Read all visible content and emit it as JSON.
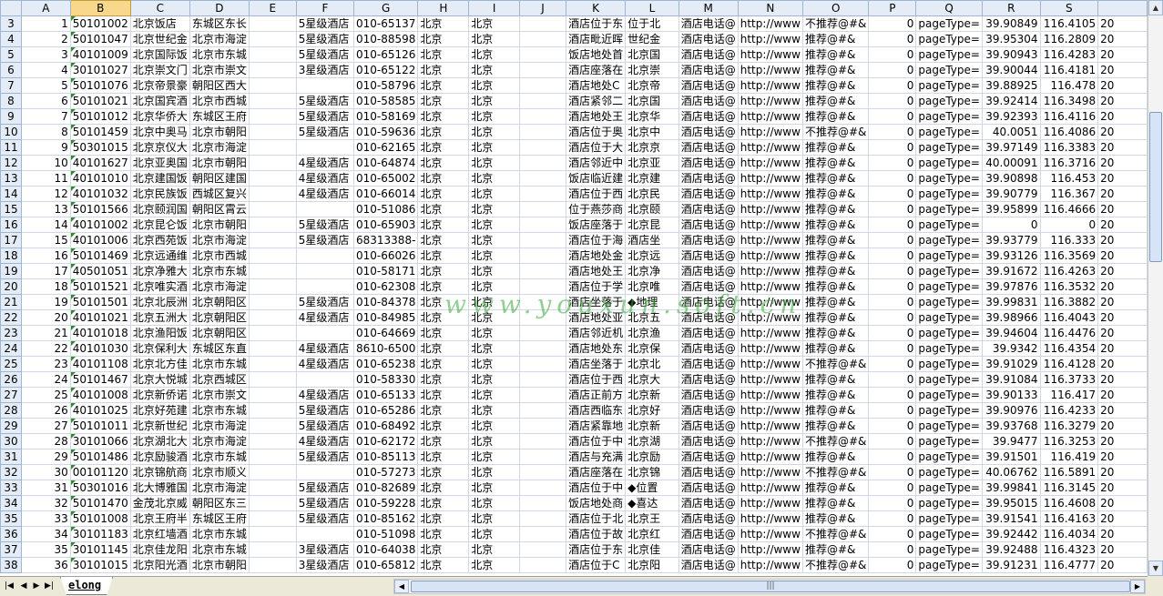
{
  "columns": [
    "A",
    "B",
    "C",
    "D",
    "E",
    "F",
    "G",
    "H",
    "I",
    "J",
    "K",
    "L",
    "M",
    "N",
    "O",
    "P",
    "Q",
    "R",
    "S"
  ],
  "selected_column": "B",
  "rows": [
    {
      "r": "3",
      "a": "1",
      "b": "50101002",
      "c": "北京饭店",
      "d": "东城区东长",
      "e": "",
      "f": "5星级酒店",
      "g": "010-65137",
      "h": "北京",
      "i": "北京",
      "j": "",
      "k": "酒店位于东",
      "l": "位于北",
      "m": "酒店电话@",
      "n": "http://www",
      "o": "不推荐@#&",
      "p": "0",
      "q": "pageType=",
      "r2": "39.90849",
      "s": "116.4105",
      "t": "20"
    },
    {
      "r": "4",
      "a": "2",
      "b": "50101047",
      "c": "北京世纪金",
      "d": "北京市海淀",
      "e": "",
      "f": "5星级酒店",
      "g": "010-88598",
      "h": "北京",
      "i": "北京",
      "j": "",
      "k": "酒店毗近晖",
      "l": "世纪金",
      "m": "酒店电话@",
      "n": "http://www",
      "o": "推荐@#&",
      "p": "0",
      "q": "pageType=",
      "r2": "39.95304",
      "s": "116.2809",
      "t": "20"
    },
    {
      "r": "5",
      "a": "3",
      "b": "40101009",
      "c": "北京国际饭",
      "d": "北京市东城",
      "e": "",
      "f": "5星级酒店",
      "g": "010-65126",
      "h": "北京",
      "i": "北京",
      "j": "",
      "k": "饭店地处首",
      "l": "北京国",
      "m": "酒店电话@",
      "n": "http://www",
      "o": "推荐@#&",
      "p": "0",
      "q": "pageType=",
      "r2": "39.90943",
      "s": "116.4283",
      "t": "20"
    },
    {
      "r": "6",
      "a": "4",
      "b": "30101027",
      "c": "北京崇文门",
      "d": "北京市崇文",
      "e": "",
      "f": "3星级酒店",
      "g": "010-65122",
      "h": "北京",
      "i": "北京",
      "j": "",
      "k": "酒店座落在",
      "l": "北京崇",
      "m": "酒店电话@",
      "n": "http://www",
      "o": "推荐@#&",
      "p": "0",
      "q": "pageType=",
      "r2": "39.90044",
      "s": "116.4181",
      "t": "20"
    },
    {
      "r": "7",
      "a": "5",
      "b": "50101076",
      "c": "北京帝景豪",
      "d": "朝阳区西大",
      "e": "",
      "f": "",
      "g": "010-58796",
      "h": "北京",
      "i": "北京",
      "j": "",
      "k": "酒店地处C",
      "l": "北京帝",
      "m": "酒店电话@",
      "n": "http://www",
      "o": "推荐@#&",
      "p": "0",
      "q": "pageType=",
      "r2": "39.88925",
      "s": "116.478",
      "t": "20"
    },
    {
      "r": "8",
      "a": "6",
      "b": "50101021",
      "c": "北京国宾酒",
      "d": "北京市西城",
      "e": "",
      "f": "5星级酒店",
      "g": "010-58585",
      "h": "北京",
      "i": "北京",
      "j": "",
      "k": "酒店紧邻二",
      "l": "北京国",
      "m": "酒店电话@",
      "n": "http://www",
      "o": "推荐@#&",
      "p": "0",
      "q": "pageType=",
      "r2": "39.92414",
      "s": "116.3498",
      "t": "20"
    },
    {
      "r": "9",
      "a": "7",
      "b": "50101012",
      "c": "北京华侨大",
      "d": "东城区王府",
      "e": "",
      "f": "5星级酒店",
      "g": "010-58169",
      "h": "北京",
      "i": "北京",
      "j": "",
      "k": "酒店地处王",
      "l": "北京华",
      "m": "酒店电话@",
      "n": "http://www",
      "o": "推荐@#&",
      "p": "0",
      "q": "pageType=",
      "r2": "39.92393",
      "s": "116.4116",
      "t": "20"
    },
    {
      "r": "10",
      "a": "8",
      "b": "50101459",
      "c": "北京中奥马",
      "d": "北京市朝阳",
      "e": "",
      "f": "5星级酒店",
      "g": "010-59636",
      "h": "北京",
      "i": "北京",
      "j": "",
      "k": "酒店位于奥",
      "l": "北京中",
      "m": "酒店电话@",
      "n": "http://www",
      "o": "不推荐@#&",
      "p": "0",
      "q": "pageType=",
      "r2": "40.0051",
      "s": "116.4086",
      "t": "20"
    },
    {
      "r": "11",
      "a": "9",
      "b": "50301015",
      "c": "北京京仪大",
      "d": "北京市海淀",
      "e": "",
      "f": "",
      "g": "010-62165",
      "h": "北京",
      "i": "北京",
      "j": "",
      "k": "酒店位于大",
      "l": "北京京",
      "m": "酒店电话@",
      "n": "http://www",
      "o": "推荐@#&",
      "p": "0",
      "q": "pageType=",
      "r2": "39.97149",
      "s": "116.3383",
      "t": "20"
    },
    {
      "r": "12",
      "a": "10",
      "b": "40101627",
      "c": "北京亚奥国",
      "d": "北京市朝阳",
      "e": "",
      "f": "4星级酒店",
      "g": "010-64874",
      "h": "北京",
      "i": "北京",
      "j": "",
      "k": "酒店邻近中",
      "l": "北京亚",
      "m": "酒店电话@",
      "n": "http://www",
      "o": "推荐@#&",
      "p": "0",
      "q": "pageType=",
      "r2": "40.00091",
      "s": "116.3716",
      "t": "20"
    },
    {
      "r": "13",
      "a": "11",
      "b": "40101010",
      "c": "北京建国饭",
      "d": "朝阳区建国",
      "e": "",
      "f": "4星级酒店",
      "g": "010-65002",
      "h": "北京",
      "i": "北京",
      "j": "",
      "k": "饭店临近建",
      "l": "北京建",
      "m": "酒店电话@",
      "n": "http://www",
      "o": "推荐@#&",
      "p": "0",
      "q": "pageType=",
      "r2": "39.90898",
      "s": "116.453",
      "t": "20"
    },
    {
      "r": "14",
      "a": "12",
      "b": "40101032",
      "c": "北京民族饭",
      "d": "西城区复兴",
      "e": "",
      "f": "4星级酒店",
      "g": "010-66014",
      "h": "北京",
      "i": "北京",
      "j": "",
      "k": "酒店位于西",
      "l": "北京民",
      "m": "酒店电话@",
      "n": "http://www",
      "o": "推荐@#&",
      "p": "0",
      "q": "pageType=",
      "r2": "39.90779",
      "s": "116.367",
      "t": "20"
    },
    {
      "r": "15",
      "a": "13",
      "b": "50101566",
      "c": "北京颐润国",
      "d": "朝阳区霄云",
      "e": "",
      "f": "",
      "g": "010-51086",
      "h": "北京",
      "i": "北京",
      "j": "",
      "k": "位于燕莎商",
      "l": "北京颐",
      "m": "酒店电话@",
      "n": "http://www",
      "o": "推荐@#&",
      "p": "0",
      "q": "pageType=",
      "r2": "39.95899",
      "s": "116.4666",
      "t": "20"
    },
    {
      "r": "16",
      "a": "14",
      "b": "40101002",
      "c": "北京昆仑饭",
      "d": "北京市朝阳",
      "e": "",
      "f": "5星级酒店",
      "g": "010-65903",
      "h": "北京",
      "i": "北京",
      "j": "",
      "k": "饭店座落于",
      "l": "北京昆",
      "m": "酒店电话@",
      "n": "http://www",
      "o": "推荐@#&",
      "p": "0",
      "q": "pageType=",
      "r2": "0",
      "s": "0",
      "t": "20"
    },
    {
      "r": "17",
      "a": "15",
      "b": "40101006",
      "c": "北京西苑饭",
      "d": "北京市海淀",
      "e": "",
      "f": "5星级酒店",
      "g": "68313388-",
      "h": "北京",
      "i": "北京",
      "j": "",
      "k": "酒店位于海",
      "l": "酒店坐",
      "m": "酒店电话@",
      "n": "http://www",
      "o": "推荐@#&",
      "p": "0",
      "q": "pageType=",
      "r2": "39.93779",
      "s": "116.333",
      "t": "20"
    },
    {
      "r": "18",
      "a": "16",
      "b": "50101469",
      "c": "北京远通维",
      "d": "北京市西城",
      "e": "",
      "f": "",
      "g": "010-66026",
      "h": "北京",
      "i": "北京",
      "j": "",
      "k": "酒店地处金",
      "l": "北京远",
      "m": "酒店电话@",
      "n": "http://www",
      "o": "推荐@#&",
      "p": "0",
      "q": "pageType=",
      "r2": "39.93126",
      "s": "116.3569",
      "t": "20"
    },
    {
      "r": "19",
      "a": "17",
      "b": "40501051",
      "c": "北京净雅大",
      "d": "北京市东城",
      "e": "",
      "f": "",
      "g": "010-58171",
      "h": "北京",
      "i": "北京",
      "j": "",
      "k": "酒店地处王",
      "l": "北京净",
      "m": "酒店电话@",
      "n": "http://www",
      "o": "推荐@#&",
      "p": "0",
      "q": "pageType=",
      "r2": "39.91672",
      "s": "116.4263",
      "t": "20"
    },
    {
      "r": "20",
      "a": "18",
      "b": "50101521",
      "c": "北京唯实酒",
      "d": "北京市海淀",
      "e": "",
      "f": "",
      "g": "010-62308",
      "h": "北京",
      "i": "北京",
      "j": "",
      "k": "酒店位于学",
      "l": "北京唯",
      "m": "酒店电话@",
      "n": "http://www",
      "o": "推荐@#&",
      "p": "0",
      "q": "pageType=",
      "r2": "39.97876",
      "s": "116.3532",
      "t": "20"
    },
    {
      "r": "21",
      "a": "19",
      "b": "50101501",
      "c": "北京北辰洲",
      "d": "北京朝阳区",
      "e": "",
      "f": "5星级酒店",
      "g": "010-84378",
      "h": "北京",
      "i": "北京",
      "j": "",
      "k": "酒店坐落于",
      "l": "◆地理",
      "m": "酒店电话@",
      "n": "http://www",
      "o": "推荐@#&",
      "p": "0",
      "q": "pageType=",
      "r2": "39.99831",
      "s": "116.3882",
      "t": "20"
    },
    {
      "r": "22",
      "a": "20",
      "b": "40101021",
      "c": "北京五洲大",
      "d": "北京朝阳区",
      "e": "",
      "f": "4星级酒店",
      "g": "010-84985",
      "h": "北京",
      "i": "北京",
      "j": "",
      "k": "酒店地处亚",
      "l": "北京五",
      "m": "酒店电话@",
      "n": "http://www",
      "o": "推荐@#&",
      "p": "0",
      "q": "pageType=",
      "r2": "39.98966",
      "s": "116.4043",
      "t": "20"
    },
    {
      "r": "23",
      "a": "21",
      "b": "40101018",
      "c": "北京渔阳饭",
      "d": "北京朝阳区",
      "e": "",
      "f": "",
      "g": "010-64669",
      "h": "北京",
      "i": "北京",
      "j": "",
      "k": "酒店邻近机",
      "l": "北京渔",
      "m": "酒店电话@",
      "n": "http://www",
      "o": "推荐@#&",
      "p": "0",
      "q": "pageType=",
      "r2": "39.94604",
      "s": "116.4476",
      "t": "20"
    },
    {
      "r": "24",
      "a": "22",
      "b": "40101030",
      "c": "北京保利大",
      "d": "东城区东直",
      "e": "",
      "f": "4星级酒店",
      "g": "8610-6500",
      "h": "北京",
      "i": "北京",
      "j": "",
      "k": "酒店地处东",
      "l": "北京保",
      "m": "酒店电话@",
      "n": "http://www",
      "o": "推荐@#&",
      "p": "0",
      "q": "pageType=",
      "r2": "39.9342",
      "s": "116.4354",
      "t": "20"
    },
    {
      "r": "25",
      "a": "23",
      "b": "40101108",
      "c": "北京北方佳",
      "d": "北京市东城",
      "e": "",
      "f": "4星级酒店",
      "g": "010-65238",
      "h": "北京",
      "i": "北京",
      "j": "",
      "k": "酒店坐落于",
      "l": "北京北",
      "m": "酒店电话@",
      "n": "http://www",
      "o": "不推荐@#&",
      "p": "0",
      "q": "pageType=",
      "r2": "39.91029",
      "s": "116.4128",
      "t": "20"
    },
    {
      "r": "26",
      "a": "24",
      "b": "50101467",
      "c": "北京大悦城",
      "d": "北京西城区",
      "e": "",
      "f": "",
      "g": "010-58330",
      "h": "北京",
      "i": "北京",
      "j": "",
      "k": "酒店位于西",
      "l": "北京大",
      "m": "酒店电话@",
      "n": "http://www",
      "o": "推荐@#&",
      "p": "0",
      "q": "pageType=",
      "r2": "39.91084",
      "s": "116.3733",
      "t": "20"
    },
    {
      "r": "27",
      "a": "25",
      "b": "40101008",
      "c": "北京新侨诺",
      "d": "北京市崇文",
      "e": "",
      "f": "4星级酒店",
      "g": "010-65133",
      "h": "北京",
      "i": "北京",
      "j": "",
      "k": "酒店正前方",
      "l": "北京新",
      "m": "酒店电话@",
      "n": "http://www",
      "o": "推荐@#&",
      "p": "0",
      "q": "pageType=",
      "r2": "39.90133",
      "s": "116.417",
      "t": "20"
    },
    {
      "r": "28",
      "a": "26",
      "b": "40101025",
      "c": "北京好苑建",
      "d": "北京市东城",
      "e": "",
      "f": "5星级酒店",
      "g": "010-65286",
      "h": "北京",
      "i": "北京",
      "j": "",
      "k": "酒店西临东",
      "l": "北京好",
      "m": "酒店电话@",
      "n": "http://www",
      "o": "推荐@#&",
      "p": "0",
      "q": "pageType=",
      "r2": "39.90976",
      "s": "116.4233",
      "t": "20"
    },
    {
      "r": "29",
      "a": "27",
      "b": "50101011",
      "c": "北京新世纪",
      "d": "北京市海淀",
      "e": "",
      "f": "5星级酒店",
      "g": "010-68492",
      "h": "北京",
      "i": "北京",
      "j": "",
      "k": "酒店紧靠地",
      "l": "北京新",
      "m": "酒店电话@",
      "n": "http://www",
      "o": "推荐@#&",
      "p": "0",
      "q": "pageType=",
      "r2": "39.93768",
      "s": "116.3279",
      "t": "20"
    },
    {
      "r": "30",
      "a": "28",
      "b": "30101066",
      "c": "北京湖北大",
      "d": "北京市海淀",
      "e": "",
      "f": "4星级酒店",
      "g": "010-62172",
      "h": "北京",
      "i": "北京",
      "j": "",
      "k": "酒店位于中",
      "l": "北京湖",
      "m": "酒店电话@",
      "n": "http://www",
      "o": "不推荐@#&",
      "p": "0",
      "q": "pageType=",
      "r2": "39.9477",
      "s": "116.3253",
      "t": "20"
    },
    {
      "r": "31",
      "a": "29",
      "b": "50101486",
      "c": "北京励骏酒",
      "d": "北京市东城",
      "e": "",
      "f": "5星级酒店",
      "g": "010-85113",
      "h": "北京",
      "i": "北京",
      "j": "",
      "k": "酒店与充满",
      "l": "北京励",
      "m": "酒店电话@",
      "n": "http://www",
      "o": "推荐@#&",
      "p": "0",
      "q": "pageType=",
      "r2": "39.91501",
      "s": "116.419",
      "t": "20"
    },
    {
      "r": "32",
      "a": "30",
      "b": "00101120",
      "c": "北京锦航商",
      "d": "北京市顺义",
      "e": "",
      "f": "",
      "g": "010-57273",
      "h": "北京",
      "i": "北京",
      "j": "",
      "k": "酒店座落在",
      "l": "北京锦",
      "m": "酒店电话@",
      "n": "http://www",
      "o": "不推荐@#&",
      "p": "0",
      "q": "pageType=",
      "r2": "40.06762",
      "s": "116.5891",
      "t": "20"
    },
    {
      "r": "33",
      "a": "31",
      "b": "50301016",
      "c": "北大博雅国",
      "d": "北京市海淀",
      "e": "",
      "f": "5星级酒店",
      "g": "010-82689",
      "h": "北京",
      "i": "北京",
      "j": "",
      "k": "酒店位于中",
      "l": "◆位置",
      "m": "酒店电话@",
      "n": "http://www",
      "o": "推荐@#&",
      "p": "0",
      "q": "pageType=",
      "r2": "39.99841",
      "s": "116.3145",
      "t": "20"
    },
    {
      "r": "34",
      "a": "32",
      "b": "50101470",
      "c": "金茂北京威",
      "d": "朝阳区东三",
      "e": "",
      "f": "5星级酒店",
      "g": "010-59228",
      "h": "北京",
      "i": "北京",
      "j": "",
      "k": "饭店地处商",
      "l": "◆喜达",
      "m": "酒店电话@",
      "n": "http://www",
      "o": "推荐@#&",
      "p": "0",
      "q": "pageType=",
      "r2": "39.95015",
      "s": "116.4608",
      "t": "20"
    },
    {
      "r": "35",
      "a": "33",
      "b": "50101008",
      "c": "北京王府半",
      "d": "东城区王府",
      "e": "",
      "f": "5星级酒店",
      "g": "010-85162",
      "h": "北京",
      "i": "北京",
      "j": "",
      "k": "酒店位于北",
      "l": "北京王",
      "m": "酒店电话@",
      "n": "http://www",
      "o": "推荐@#&",
      "p": "0",
      "q": "pageType=",
      "r2": "39.91541",
      "s": "116.4163",
      "t": "20"
    },
    {
      "r": "36",
      "a": "34",
      "b": "30101183",
      "c": "北京红墙酒",
      "d": "北京市东城",
      "e": "",
      "f": "",
      "g": "010-51098",
      "h": "北京",
      "i": "北京",
      "j": "",
      "k": "酒店位于故",
      "l": "北京红",
      "m": "酒店电话@",
      "n": "http://www",
      "o": "不推荐@#&",
      "p": "0",
      "q": "pageType=",
      "r2": "39.92442",
      "s": "116.4034",
      "t": "20"
    },
    {
      "r": "37",
      "a": "35",
      "b": "30101145",
      "c": "北京佳龙阳",
      "d": "北京市东城",
      "e": "",
      "f": "3星级酒店",
      "g": "010-64038",
      "h": "北京",
      "i": "北京",
      "j": "",
      "k": "酒店位于东",
      "l": "北京佳",
      "m": "酒店电话@",
      "n": "http://www",
      "o": "推荐@#&",
      "p": "0",
      "q": "pageType=",
      "r2": "39.92488",
      "s": "116.4323",
      "t": "20"
    },
    {
      "r": "38",
      "a": "36",
      "b": "30101015",
      "c": "北京阳光酒",
      "d": "北京市朝阳",
      "e": "",
      "f": "3星级酒店",
      "g": "010-65812",
      "h": "北京",
      "i": "北京",
      "j": "",
      "k": "酒店位于C",
      "l": "北京阳",
      "m": "酒店电话@",
      "n": "http://www",
      "o": "不推荐@#&",
      "p": "0",
      "q": "pageType=",
      "r2": "39.91231",
      "s": "116.4777",
      "t": "20"
    }
  ],
  "watermark": "www.youxun.soft.cn",
  "sheet_tab": "elong",
  "colors": {
    "header_bg": "#e4ecf7",
    "selected_header": "#f8d88a",
    "grid": "#d0d7e5",
    "watermark": "#3aa83a"
  }
}
